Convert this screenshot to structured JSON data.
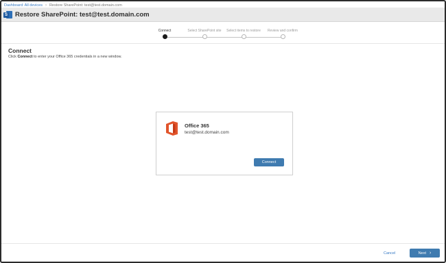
{
  "breadcrumb": {
    "dashboard": "Dashboard: All devices",
    "current": "Restore SharePoint: test@test.domain.com"
  },
  "header": {
    "icon": "sharepoint-icon",
    "title": "Restore SharePoint: test@test.domain.com"
  },
  "wizard": {
    "steps": [
      {
        "label": "Connect",
        "state": "active"
      },
      {
        "label": "Select SharePoint site",
        "state": "pending"
      },
      {
        "label": "Select items to restore",
        "state": "pending"
      },
      {
        "label": "Review and confirm",
        "state": "pending"
      }
    ]
  },
  "main": {
    "section_title": "Connect",
    "instruction_pre": "Click ",
    "instruction_bold": "Connect",
    "instruction_post": " to enter your Office 365 credentials in a new window."
  },
  "card": {
    "icon": "office-365-logo",
    "service": "Office 365",
    "account": "test@test.domain.com",
    "connect_label": "Connect"
  },
  "footer": {
    "cancel_label": "Cancel",
    "next_label": "Next",
    "next_icon": "chevron-right-icon"
  },
  "colors": {
    "accent": "#3f7bb0",
    "link": "#3578c4",
    "office_orange": "#e1542b"
  }
}
